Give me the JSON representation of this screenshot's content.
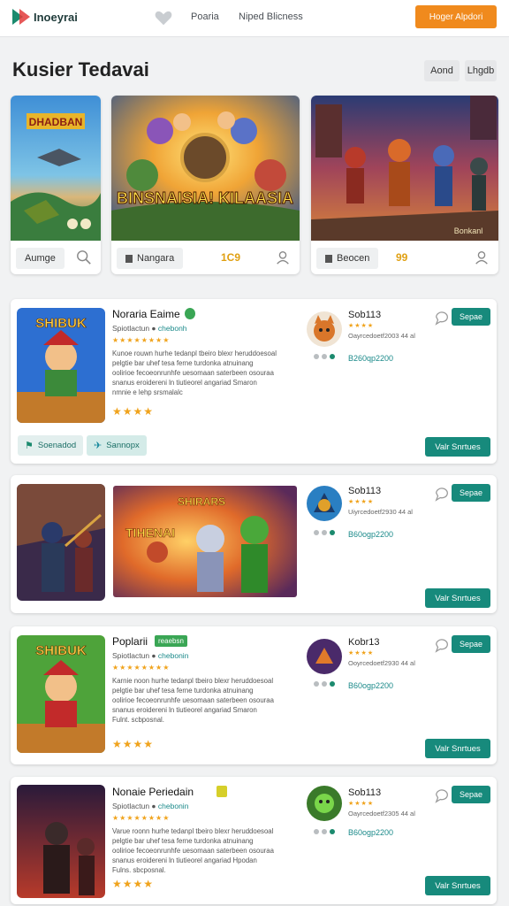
{
  "nav": {
    "brand": "Inoeyrai",
    "links": [
      "Poaria",
      "Niped Blicness"
    ],
    "cta": "Hoger Alpdori"
  },
  "page": {
    "title": "Kusier Tedavai",
    "pills": [
      "Aond",
      "Lhgdb"
    ]
  },
  "featured": [
    {
      "art_text": "DHADBAN",
      "chip": "Aumge",
      "num": ""
    },
    {
      "art_text": "BINSNAISIA! KILAASIA",
      "chip": "Nangara",
      "num": "1C9"
    },
    {
      "art_text": "Bonkanl",
      "chip": "Beocen",
      "num": "99"
    }
  ],
  "cards": [
    {
      "thumb_text": "SHIBUK",
      "title": "Noraria Eaime",
      "sub_prefix": "Spiotlactun",
      "sub_link": "chebonh",
      "desc": "Kunoe rouwn hurhe tedanpl tbeiro blexr heruddoesoal\npelgtie bar uhef tesa ferne turdonka atnuinang\noolirioe fecoeonrunhfe uesomaan saterbeen osouraa\nsnanus eroidereni ln tiutieorel angariad Smaron\nnmnie e lehp srsmalalc",
      "seller": "Sob113",
      "seller_meta": "Oayrcedoetf2003 44 al",
      "code": "B260qp2200",
      "small_btn": "Sepae",
      "action": "Valr Snrtues",
      "soft_buttons": [
        "Soenadod",
        "Sannopx"
      ]
    },
    {
      "art_text": "TIHENAI",
      "art_banner": "SHIRARS",
      "seller": "Sob113",
      "seller_meta": "Uiyrcedoetf2930 44 al",
      "code": "B60ogp2200",
      "small_btn": "Sepae",
      "action": "Valr Snrtues"
    },
    {
      "thumb_text": "SHIBUK",
      "title": "Poplarii",
      "tag": "reaebsn",
      "sub_prefix": "Spiotlactun",
      "sub_link": "chebonin",
      "desc": "Karnie noon hurhe tedanpl tbeiro blexr heruddoesoal\npelgtie bar uhef tesa ferne turdonka atnuinang\noolirioe fecoeonrunhfe uesomaan saterbeen osouraa\nsnanus eroidereni ln tiutieorel angariad Smaron\nFulnt. scbposnal.",
      "seller": "Kobr13",
      "seller_meta": "Ooyrcedoetf2930 44 al",
      "code": "B60ogp2200",
      "small_btn": "Sepae",
      "action": "Valr Snrtues"
    },
    {
      "title": "Nonaie Periedain",
      "sub_prefix": "Spiotlactun",
      "sub_link": "chebonin",
      "desc": "Varue roonn hurhe tedanpl tbeiro blexr heruddoesoal\npelgtie bar uhef tesa ferne turdonka atnuinang\noolirioe fecoeonrunhfe uesomaan saterbeen osouraa\nsnanus eroidereni ln tiutieorel angariad Hpodan\nFulns. sbcposnal.",
      "seller": "Sob113",
      "seller_meta": "Oayrcedoetf2305 44 al",
      "code": "B60ogp2200",
      "small_btn": "Sepae",
      "action": "Valr Snrtues"
    }
  ],
  "colors": {
    "accent": "#178a7c",
    "cta": "#f08a1d",
    "star": "#f0a31c"
  }
}
